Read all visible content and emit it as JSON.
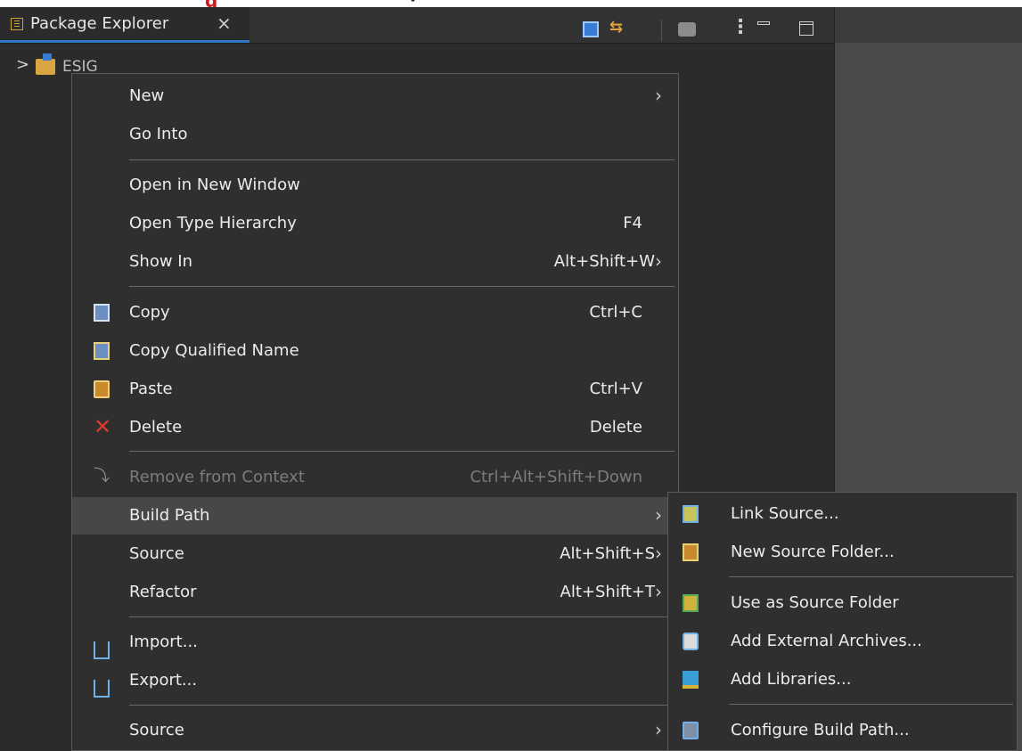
{
  "view": {
    "tab_label": "Package Explorer",
    "close_glyph": "×",
    "toolbar_icons": [
      "collapse-all-icon",
      "link-with-editor-icon",
      "filter-icon",
      "view-menu-icon",
      "minimize-icon",
      "maximize-icon"
    ]
  },
  "tree": {
    "project_label": "ESIG",
    "expander": ">"
  },
  "context_menu": {
    "items": [
      {
        "label": "New",
        "accel": "",
        "submenu": true
      },
      {
        "label": "Go Into",
        "accel": "",
        "submenu": false
      },
      {
        "label": "Open in New Window",
        "accel": "",
        "submenu": false
      },
      {
        "label": "Open Type Hierarchy",
        "accel": "F4",
        "submenu": false
      },
      {
        "label": "Show In",
        "accel": "Alt+Shift+W",
        "submenu": true
      },
      {
        "label": "Copy",
        "accel": "Ctrl+C",
        "submenu": false,
        "icon": "copy-icon"
      },
      {
        "label": "Copy Qualified Name",
        "accel": "",
        "submenu": false,
        "icon": "copy-qualified-name-icon"
      },
      {
        "label": "Paste",
        "accel": "Ctrl+V",
        "submenu": false,
        "icon": "paste-icon"
      },
      {
        "label": "Delete",
        "accel": "Delete",
        "submenu": false,
        "icon": "delete-icon"
      },
      {
        "label": "Remove from Context",
        "accel": "Ctrl+Alt+Shift+Down",
        "submenu": false,
        "disabled": true,
        "icon": "remove-context-icon"
      },
      {
        "label": "Build Path",
        "accel": "",
        "submenu": true,
        "highlighted": true
      },
      {
        "label": "Source",
        "accel": "Alt+Shift+S",
        "submenu": true
      },
      {
        "label": "Refactor",
        "accel": "Alt+Shift+T",
        "submenu": true
      },
      {
        "label": "Import...",
        "accel": "",
        "submenu": false,
        "icon": "import-icon"
      },
      {
        "label": "Export...",
        "accel": "",
        "submenu": false,
        "icon": "export-icon"
      },
      {
        "label": "Source",
        "accel": "",
        "submenu": true
      }
    ]
  },
  "build_path_submenu": {
    "items": [
      {
        "label": "Link Source...",
        "icon": "link-source-icon"
      },
      {
        "label": "New Source Folder...",
        "icon": "new-source-folder-icon"
      },
      {
        "label": "Use as Source Folder",
        "icon": "use-as-source-folder-icon"
      },
      {
        "label": "Add External Archives...",
        "icon": "add-external-archives-icon"
      },
      {
        "label": "Add Libraries...",
        "icon": "add-libraries-icon"
      },
      {
        "label": "Configure Build Path...",
        "icon": "configure-build-path-icon"
      }
    ]
  },
  "colors": {
    "menu_bg": "#2f2f2f",
    "highlight": "#474747",
    "tab_underline": "#2f79c4",
    "delete_red": "#e03a2f"
  }
}
